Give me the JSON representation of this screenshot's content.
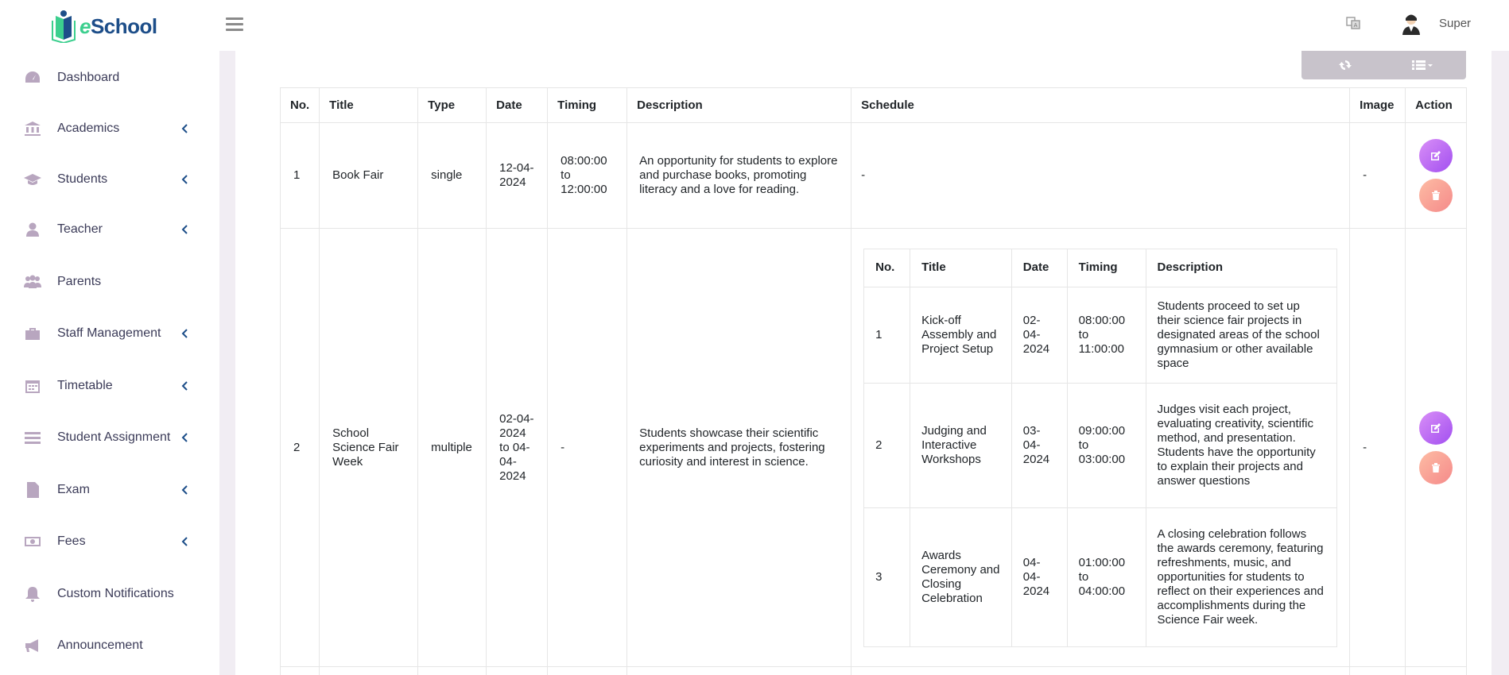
{
  "brand": {
    "prefix": "e",
    "name": "School"
  },
  "header": {
    "user_name": "Super"
  },
  "sidebar": {
    "items": [
      {
        "label": "Dashboard",
        "icon": "dashboard-icon",
        "has_submenu": false
      },
      {
        "label": "Academics",
        "icon": "bank-icon",
        "has_submenu": true
      },
      {
        "label": "Students",
        "icon": "graduation-cap-icon",
        "has_submenu": true
      },
      {
        "label": "Teacher",
        "icon": "user-icon",
        "has_submenu": true
      },
      {
        "label": "Parents",
        "icon": "users-icon",
        "has_submenu": false
      },
      {
        "label": "Staff Management",
        "icon": "briefcase-icon",
        "has_submenu": true
      },
      {
        "label": "Timetable",
        "icon": "calendar-icon",
        "has_submenu": true
      },
      {
        "label": "Student Assignment",
        "icon": "tasks-icon",
        "has_submenu": true
      },
      {
        "label": "Exam",
        "icon": "document-icon",
        "has_submenu": true
      },
      {
        "label": "Fees",
        "icon": "money-icon",
        "has_submenu": true
      },
      {
        "label": "Custom Notifications",
        "icon": "bell-icon",
        "has_submenu": false
      },
      {
        "label": "Announcement",
        "icon": "bullhorn-icon",
        "has_submenu": false
      }
    ]
  },
  "table": {
    "headers": [
      "No.",
      "Title",
      "Type",
      "Date",
      "Timing",
      "Description",
      "Schedule",
      "Image",
      "Action"
    ],
    "rows": [
      {
        "no": "1",
        "title": "Book Fair",
        "type": "single",
        "date": "12-04-2024",
        "timing": "08:00:00 to 12:00:00",
        "description": "An opportunity for students to explore and purchase books, promoting literacy and a love for reading.",
        "schedule": "-",
        "image": "-"
      },
      {
        "no": "2",
        "title": "School Science Fair Week",
        "type": "multiple",
        "date": "02-04-2024 to 04-04-2024",
        "timing": "-",
        "description": "Students showcase their scientific experiments and projects, fostering curiosity and interest in science.",
        "image": "-",
        "schedule": {
          "headers": [
            "No.",
            "Title",
            "Date",
            "Timing",
            "Description"
          ],
          "rows": [
            {
              "no": "1",
              "title": "Kick-off Assembly and Project Setup",
              "date": "02-04-2024",
              "timing": "08:00:00 to 11:00:00",
              "description": "Students proceed to set up their science fair projects in designated areas of the school gymnasium or other available space"
            },
            {
              "no": "2",
              "title": "Judging and Interactive Workshops",
              "date": "03-04-2024",
              "timing": "09:00:00 to 03:00:00",
              "description": "Judges visit each project, evaluating creativity, scientific method, and presentation. Students have the opportunity to explain their projects and answer questions"
            },
            {
              "no": "3",
              "title": "Awards Ceremony and Closing Celebration",
              "date": "04-04-2024",
              "timing": "01:00:00 to 04:00:00",
              "description": "A closing celebration follows the awards ceremony, featuring refreshments, music, and opportunities for students to reflect on their experiences and accomplishments during the Science Fair week."
            }
          ]
        }
      }
    ]
  },
  "colors": {
    "brand_green": "#3ccf8e",
    "brand_blue": "#1d4e89",
    "sidebar_icon": "#b8a6bf",
    "edit_button": "#b05cf2",
    "delete_button": "#f7a095",
    "toolbar": "#c8c3cb"
  }
}
